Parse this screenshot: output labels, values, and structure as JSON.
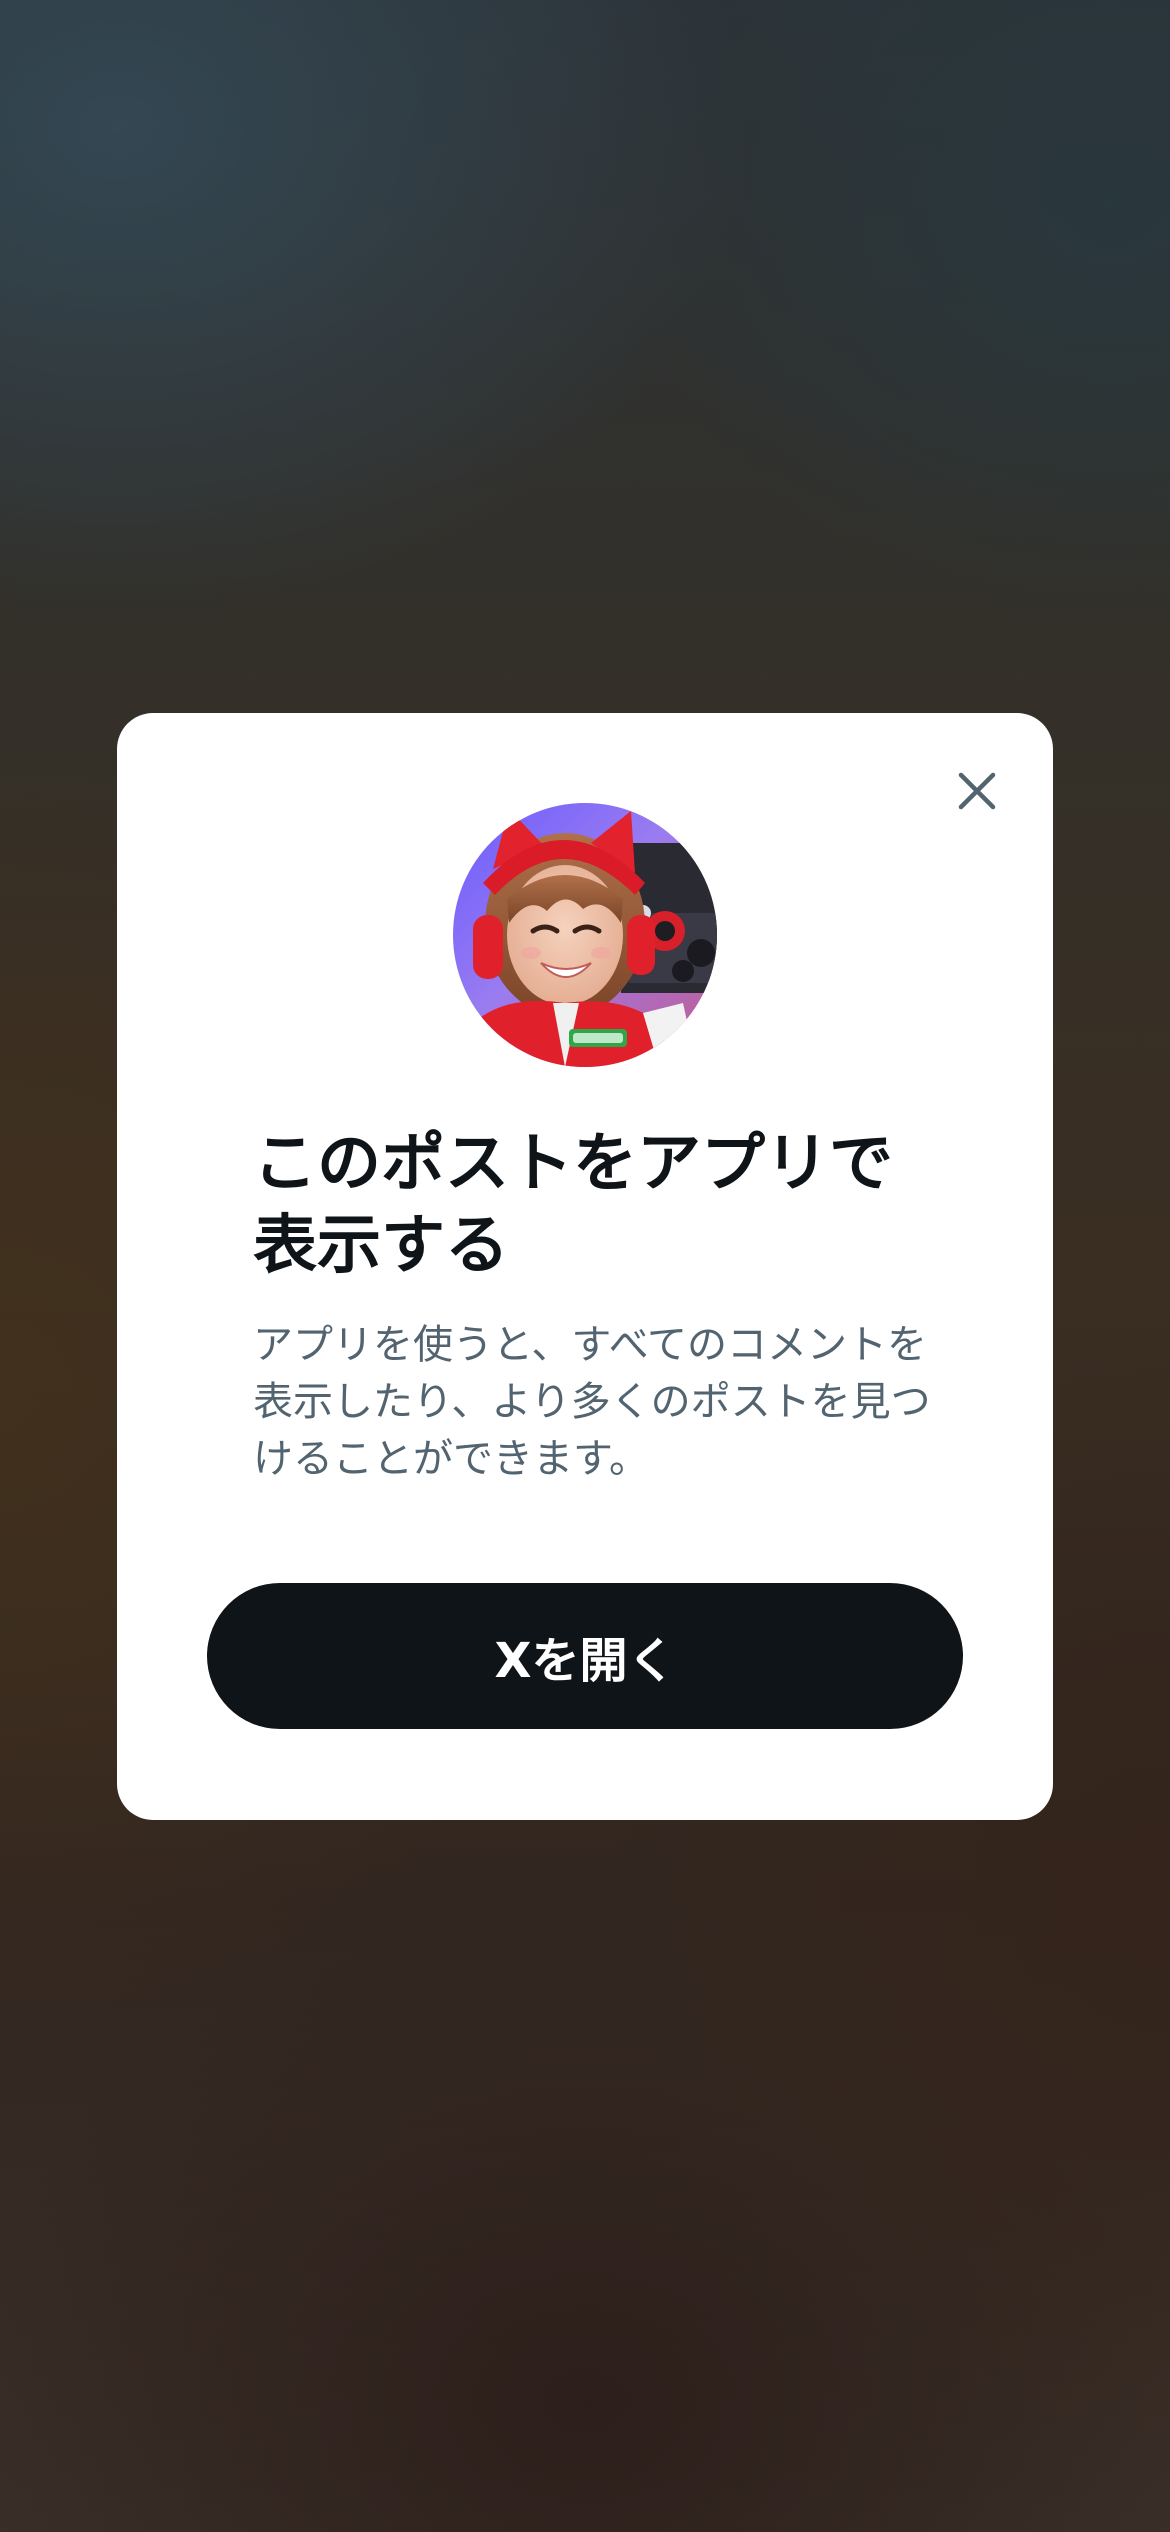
{
  "modal": {
    "title": "このポストをアプリで表示する",
    "body": "アプリを使うと、すべてのコメントを表示したり、より多くのポストを見つけることができます。",
    "primary_button_label": "Xを開く",
    "close_icon": "close-icon",
    "avatar_alt": "avatar"
  },
  "colors": {
    "primary_button_bg": "#0f1419",
    "title_text": "#0f1419",
    "body_text": "#536471",
    "close_icon": "#536471",
    "modal_bg": "#ffffff"
  }
}
